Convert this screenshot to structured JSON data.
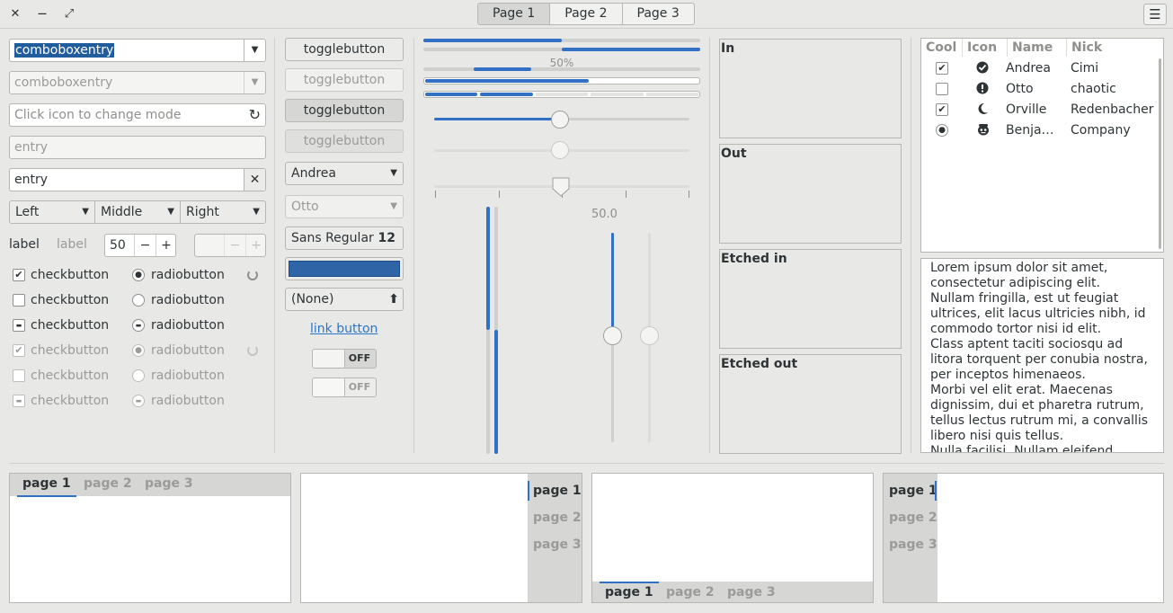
{
  "titlebar": {
    "close_glyph": "✕",
    "minimize_glyph": "—",
    "maximize_glyph": "⤢",
    "pages": [
      "Page 1",
      "Page 2",
      "Page 3"
    ],
    "menu_glyph": "☰"
  },
  "col1": {
    "combo1_value": "comboboxentry",
    "combo2_value": "comboboxentry",
    "entry_mode_placeholder": "Click icon to change mode",
    "entry_disabled": "entry",
    "entry_clear": "entry",
    "seg": [
      "Left",
      "Middle",
      "Right"
    ],
    "label": "label",
    "label_disabled": "label",
    "spin_value": "50",
    "spin_minus": "−",
    "spin_plus": "+",
    "checkbutton_label": "checkbutton",
    "radiobutton_label": "radiobutton"
  },
  "col2": {
    "toggle_label": "togglebutton",
    "combo_andrea": "Andrea",
    "combo_otto": "Otto",
    "font_name": "Sans Regular",
    "font_size": "12",
    "color_value": "#2f65a6",
    "file_none": "(None)",
    "link_label": "link button",
    "switch_off": "OFF"
  },
  "col3": {
    "progress_percent_label": "50%",
    "progress_values": [
      0.5,
      0.5,
      0.6
    ],
    "scale_value_label": "50.0",
    "scale_value": 50
  },
  "frames": [
    "In",
    "Out",
    "Etched in",
    "Etched out"
  ],
  "tree": {
    "headers": [
      "Cool",
      "Icon",
      "Name",
      "Nick"
    ],
    "rows": [
      {
        "cool": "check",
        "icon": "check-circle-icon",
        "name": "Andrea",
        "nick": "Cimi"
      },
      {
        "cool": "none",
        "icon": "exclamation-circle-icon",
        "name": "Otto",
        "nick": "chaotic"
      },
      {
        "cool": "check",
        "icon": "moon-icon",
        "name": "Orville",
        "nick": "Redenbacher"
      },
      {
        "cool": "radio",
        "icon": "face-icon",
        "name": "Benja…",
        "nick": "Company"
      }
    ]
  },
  "textview": {
    "lines": [
      "Lorem ipsum dolor sit amet,",
      "consectetur adipiscing elit.",
      "Nullam fringilla, est ut feugiat",
      "ultrices, elit lacus ultricies nibh, id",
      "commodo tortor nisi id elit.",
      "Class aptent taciti sociosqu ad",
      "litora torquent per conubia nostra,",
      "per inceptos himenaeos.",
      "Morbi vel elit erat. Maecenas",
      "dignissim, dui et pharetra rutrum,",
      "tellus lectus rutrum mi, a convallis",
      "libero nisi quis tellus.",
      "Nulla facilisi. Nullam eleifend"
    ]
  },
  "notebook_tabs": [
    "page 1",
    "page 2",
    "page 3"
  ],
  "colors": {
    "accent": "#3170c4",
    "selection": "#215d9c",
    "link": "#2a76c6"
  }
}
